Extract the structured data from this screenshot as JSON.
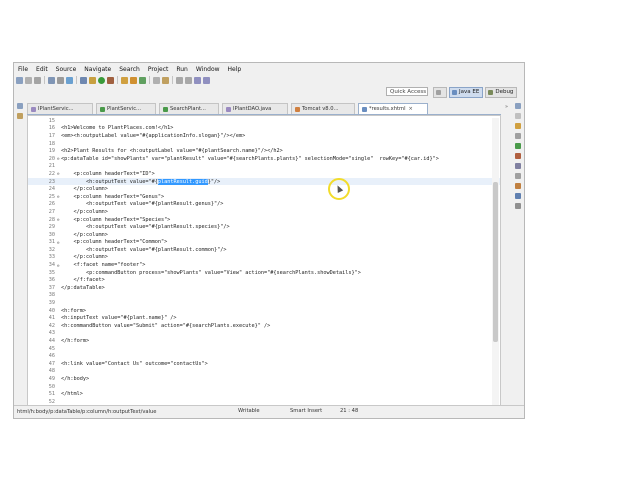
{
  "menubar": [
    "File",
    "Edit",
    "Source",
    "Navigate",
    "Search",
    "Project",
    "Run",
    "Window",
    "Help"
  ],
  "quick_access": "Quick Access",
  "perspectives": [
    {
      "label": "Java EE",
      "active": true
    },
    {
      "label": "Debug",
      "active": false
    }
  ],
  "tabs": [
    {
      "label": "IPlantServic...",
      "active": false
    },
    {
      "label": "PlantServic...",
      "active": false
    },
    {
      "label": "SearchPlant...",
      "active": false
    },
    {
      "label": "IPlantDAO.java",
      "active": false
    },
    {
      "label": "Tomcat v8.0...",
      "active": false
    },
    {
      "label": "*results.xhtml",
      "active": true
    }
  ],
  "tab_overflow": "»",
  "code_lines": [
    {
      "n": "15",
      "t": ""
    },
    {
      "n": "16",
      "t": "<h1>Welcome to PlantPlaces.com!</h1>"
    },
    {
      "n": "17",
      "t": "<em><h:outputLabel value=\"#{applicationInfo.slogan}\"/></em>"
    },
    {
      "n": "18",
      "t": ""
    },
    {
      "n": "19",
      "t": "<h2>Plant Results for <h:outputLabel value=\"#{plantSearch.name}\"/></h2>"
    },
    {
      "n": "20",
      "t": "<p:dataTable id=\"showPlants\" var=\"plantResult\" value=\"#{searchPlants.plants}\" selectionMode=\"single\"  rowKey=\"#{car.id}\">"
    },
    {
      "n": "21",
      "t": ""
    },
    {
      "n": "22",
      "t": "    <p:column headerText=\"ID\">"
    },
    {
      "n": "23",
      "t": "        <h:outputText value=\"#{plantResult.guid}\"/>",
      "sel": "plantResult.guid",
      "cur": true
    },
    {
      "n": "24",
      "t": "    </p:column>"
    },
    {
      "n": "25",
      "t": "    <p:column headerText=\"Genus\">"
    },
    {
      "n": "26",
      "t": "        <h:outputText value=\"#{plantResult.genus}\"/>"
    },
    {
      "n": "27",
      "t": "    </p:column>"
    },
    {
      "n": "28",
      "t": "    <p:column headerText=\"Species\">"
    },
    {
      "n": "29",
      "t": "        <h:outputText value=\"#{plantResult.species}\"/>"
    },
    {
      "n": "30",
      "t": "    </p:column>"
    },
    {
      "n": "31",
      "t": "    <p:column headerText=\"Common\">"
    },
    {
      "n": "32",
      "t": "        <h:outputText value=\"#{plantResult.common}\"/>"
    },
    {
      "n": "33",
      "t": "    </p:column>"
    },
    {
      "n": "34",
      "t": "    <f:facet name=\"footer\">"
    },
    {
      "n": "35",
      "t": "        <p:commandButton process=\"showPlants\" value=\"View\" action=\"#{searchPlants.showDetails}\">"
    },
    {
      "n": "36",
      "t": "    </f:facet>"
    },
    {
      "n": "37",
      "t": "</p:dataTable>"
    },
    {
      "n": "38",
      "t": ""
    },
    {
      "n": "39",
      "t": ""
    },
    {
      "n": "40",
      "t": "<h:form>"
    },
    {
      "n": "41",
      "t": "<h:inputText value=\"#{plant.name}\" />"
    },
    {
      "n": "42",
      "t": "<h:commandButton value=\"Submit\" action=\"#{searchPlants.execute}\" />"
    },
    {
      "n": "43",
      "t": ""
    },
    {
      "n": "44",
      "t": "</h:form>"
    },
    {
      "n": "45",
      "t": ""
    },
    {
      "n": "46",
      "t": ""
    },
    {
      "n": "47",
      "t": "<h:link value=\"Contact Us\" outcome=\"contactUs\">"
    },
    {
      "n": "48",
      "t": ""
    },
    {
      "n": "49",
      "t": "</h:body>"
    },
    {
      "n": "50",
      "t": ""
    },
    {
      "n": "51",
      "t": "</html>"
    },
    {
      "n": "52",
      "t": ""
    }
  ],
  "status": {
    "path": "html/h:body/p:dataTable/p:column/h:outputText/value",
    "mode": "Writable",
    "insert": "Smart Insert",
    "position": "21 : 48"
  },
  "colors": {
    "selection": "#3399ff",
    "current_line": "#e8f0fa",
    "tab_border": "#9bb0cc"
  }
}
